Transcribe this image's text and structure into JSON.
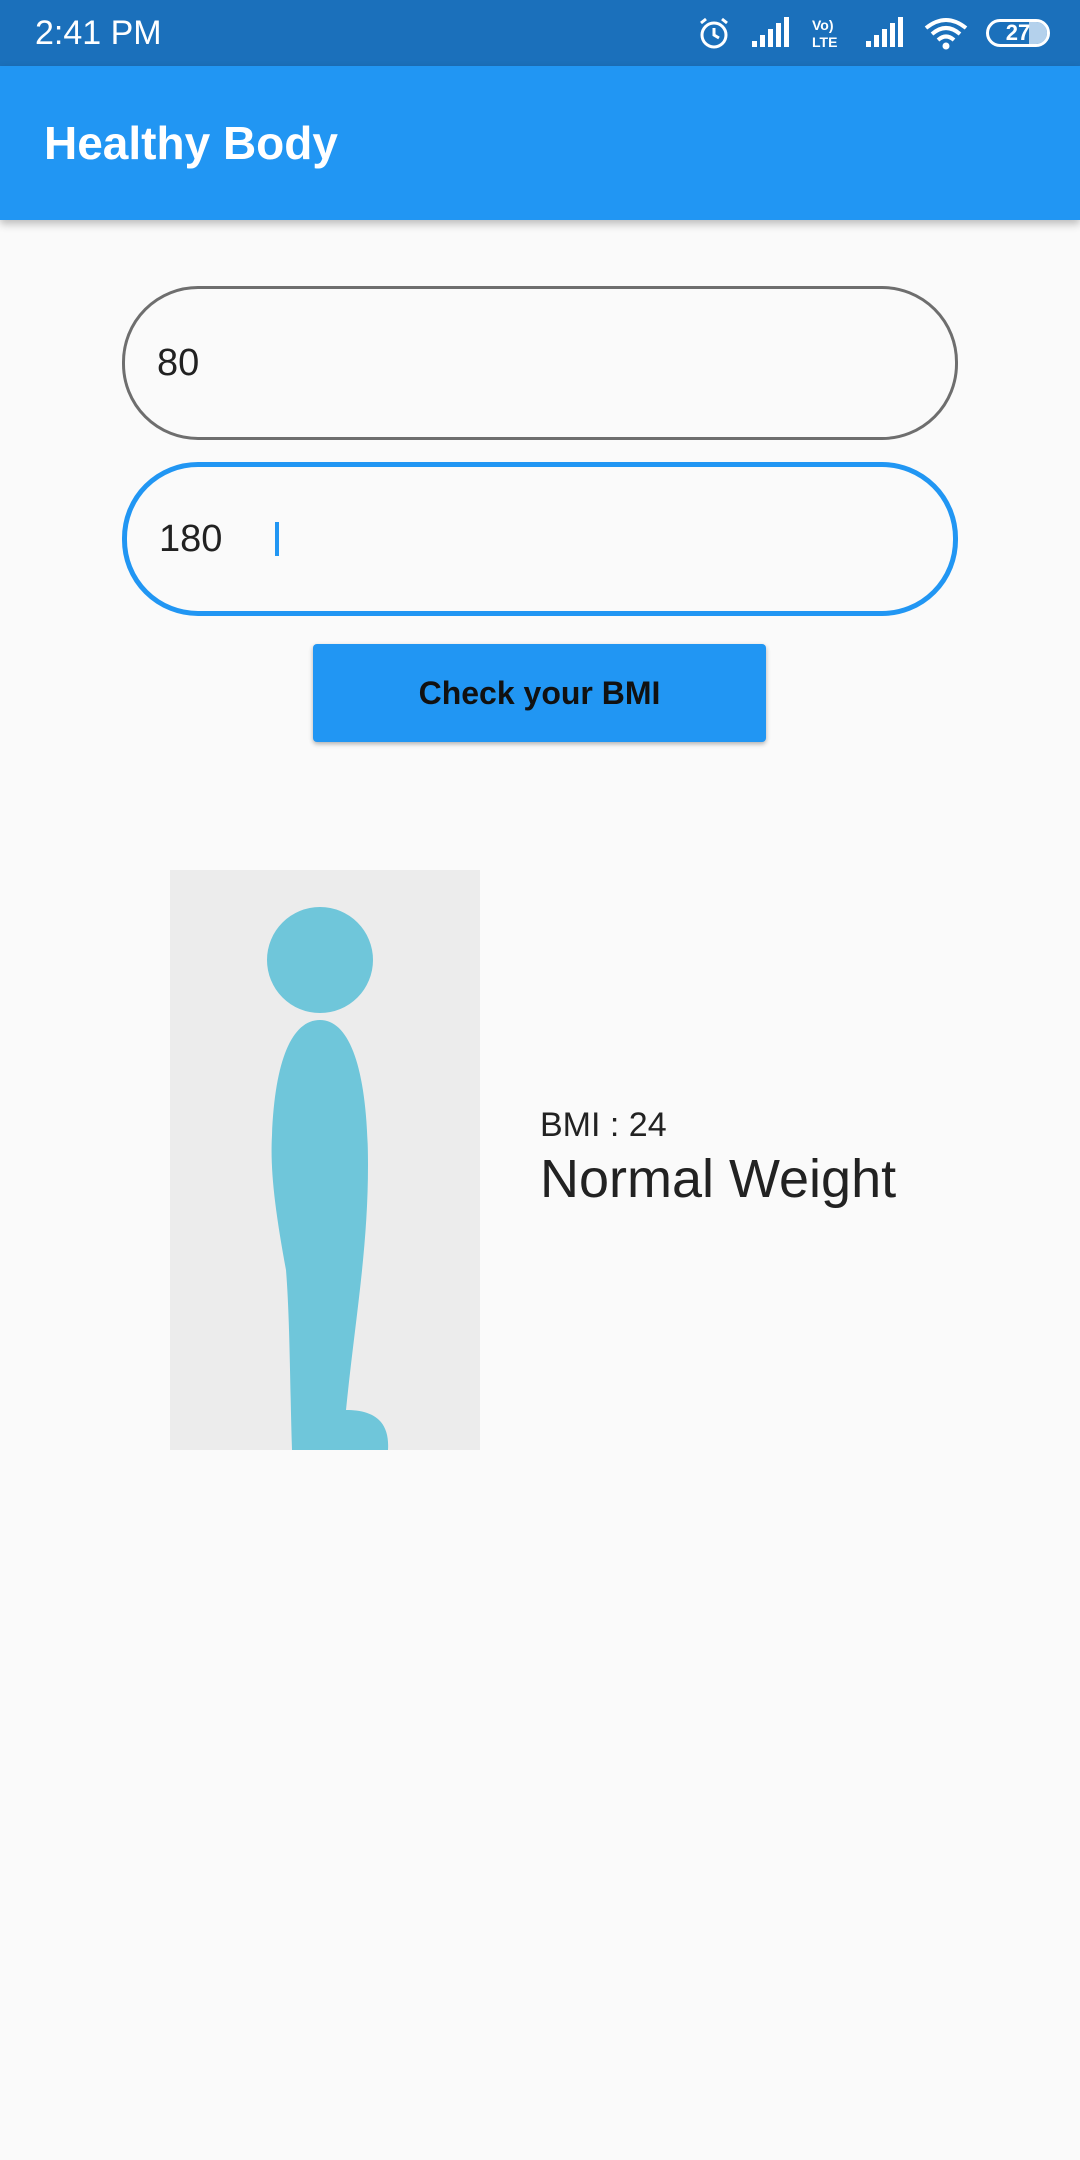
{
  "status_bar": {
    "time": "2:41 PM",
    "battery": "27",
    "icons": [
      "alarm-icon",
      "signal-icon",
      "volte-icon",
      "signal-icon",
      "wifi-icon",
      "battery-icon"
    ]
  },
  "app_bar": {
    "title": "Healthy Body"
  },
  "form": {
    "weight_value": "80",
    "height_value": "180",
    "submit_label": "Check your BMI"
  },
  "result": {
    "bmi_text": "BMI : 24",
    "category": "Normal Weight",
    "figure_icon": "body-figure-icon"
  },
  "colors": {
    "status_bar": "#1b70bb",
    "primary": "#2196f3",
    "background": "#fafafa",
    "figure_panel": "#ececec",
    "figure": "#6fc6da"
  }
}
